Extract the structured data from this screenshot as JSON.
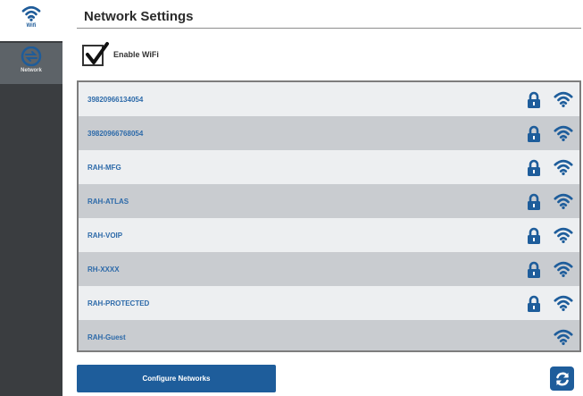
{
  "sidebar": {
    "items": [
      {
        "label": "Wifi",
        "icon": "wifi-icon",
        "active": true
      },
      {
        "label": "Network",
        "icon": "network-icon",
        "active": false
      }
    ]
  },
  "header": {
    "title": "Network Settings"
  },
  "enable_wifi": {
    "label": "Enable WiFi",
    "checked": true
  },
  "networks": [
    {
      "name": "39820966134054",
      "secured": true
    },
    {
      "name": "39820966768054",
      "secured": true
    },
    {
      "name": "RAH-MFG",
      "secured": true
    },
    {
      "name": "RAH-ATLAS",
      "secured": true
    },
    {
      "name": "RAH-VOIP",
      "secured": true
    },
    {
      "name": "RH-XXXX",
      "secured": true
    },
    {
      "name": "RAH-PROTECTED",
      "secured": true
    },
    {
      "name": "RAH-Guest",
      "secured": false
    }
  ],
  "footer": {
    "configure_label": "Configure Networks",
    "refresh_icon": "refresh-icon"
  },
  "colors": {
    "accent": "#1e5d9b",
    "sidebar": "#3a3d40",
    "network_text": "#2d6aa9"
  }
}
